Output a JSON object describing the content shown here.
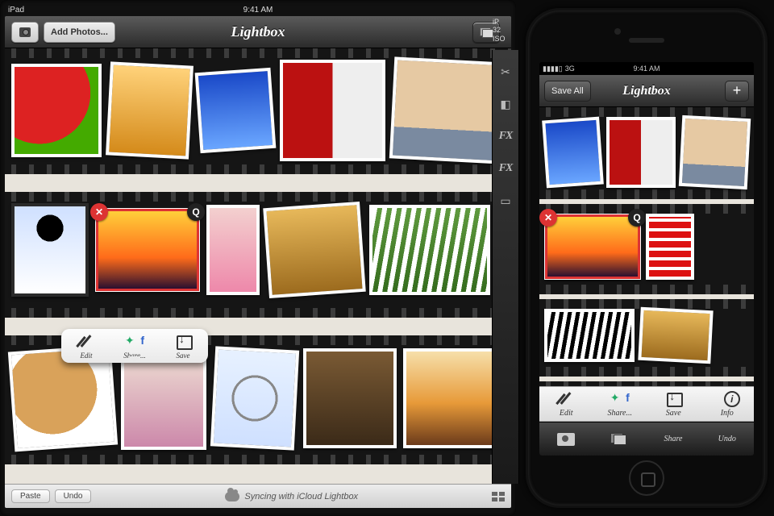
{
  "ipad": {
    "status": {
      "device": "iPad",
      "time": "9:41 AM"
    },
    "toolbar": {
      "title": "Lightbox",
      "add_photos_label": "Add Photos..."
    },
    "popover": {
      "edit_label": "Edit",
      "share_label": "Share...",
      "save_label": "Save"
    },
    "footer": {
      "paste_label": "Paste",
      "undo_label": "Undo",
      "sync_label": "Syncing with iCloud Lightbox"
    }
  },
  "siderail": {
    "heading_line1": "iP",
    "heading_line2": "32",
    "heading_line3": "ISO",
    "fx_label": "FX",
    "fx_label2": "FX"
  },
  "iphone": {
    "status": {
      "carrier": "3G",
      "time": "9:41 AM"
    },
    "toolbar": {
      "title": "Lightbox",
      "save_all_label": "Save All",
      "add_symbol": "+"
    },
    "actionbar": {
      "edit_label": "Edit",
      "share_label": "Share...",
      "save_label": "Save",
      "info_label": "Info"
    },
    "tabbar": {
      "share_label": "Share",
      "undo_label": "Undo"
    }
  }
}
